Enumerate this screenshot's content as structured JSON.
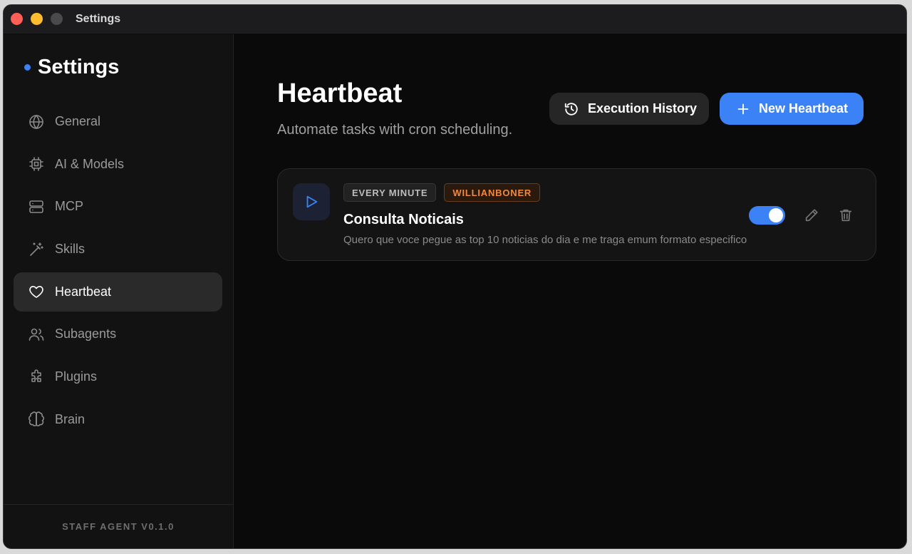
{
  "window": {
    "title": "Settings"
  },
  "sidebar": {
    "title": "Settings",
    "items": [
      {
        "label": "General",
        "icon": "globe-icon"
      },
      {
        "label": "AI & Models",
        "icon": "cpu-icon"
      },
      {
        "label": "MCP",
        "icon": "server-icon"
      },
      {
        "label": "Skills",
        "icon": "magic-wand-icon"
      },
      {
        "label": "Heartbeat",
        "icon": "heart-icon",
        "active": true
      },
      {
        "label": "Subagents",
        "icon": "users-icon"
      },
      {
        "label": "Plugins",
        "icon": "puzzle-icon"
      },
      {
        "label": "Brain",
        "icon": "brain-icon"
      }
    ],
    "footer": "STAFF AGENT V0.1.0"
  },
  "main": {
    "title": "Heartbeat",
    "subtitle": "Automate tasks with cron scheduling.",
    "history_button": "Execution History",
    "new_button": "New Heartbeat"
  },
  "heartbeats": [
    {
      "schedule": "EVERY MINUTE",
      "user": "WILLIANBONER",
      "title": "Consulta Noticais",
      "description": "Quero que voce pegue as top 10 noticias do dia e me traga emum formato especifico",
      "enabled": true
    }
  ],
  "colors": {
    "accent": "#3b82f6",
    "user_badge": "#f0883e",
    "background": "#0a0a0a",
    "sidebar": "#121212"
  }
}
